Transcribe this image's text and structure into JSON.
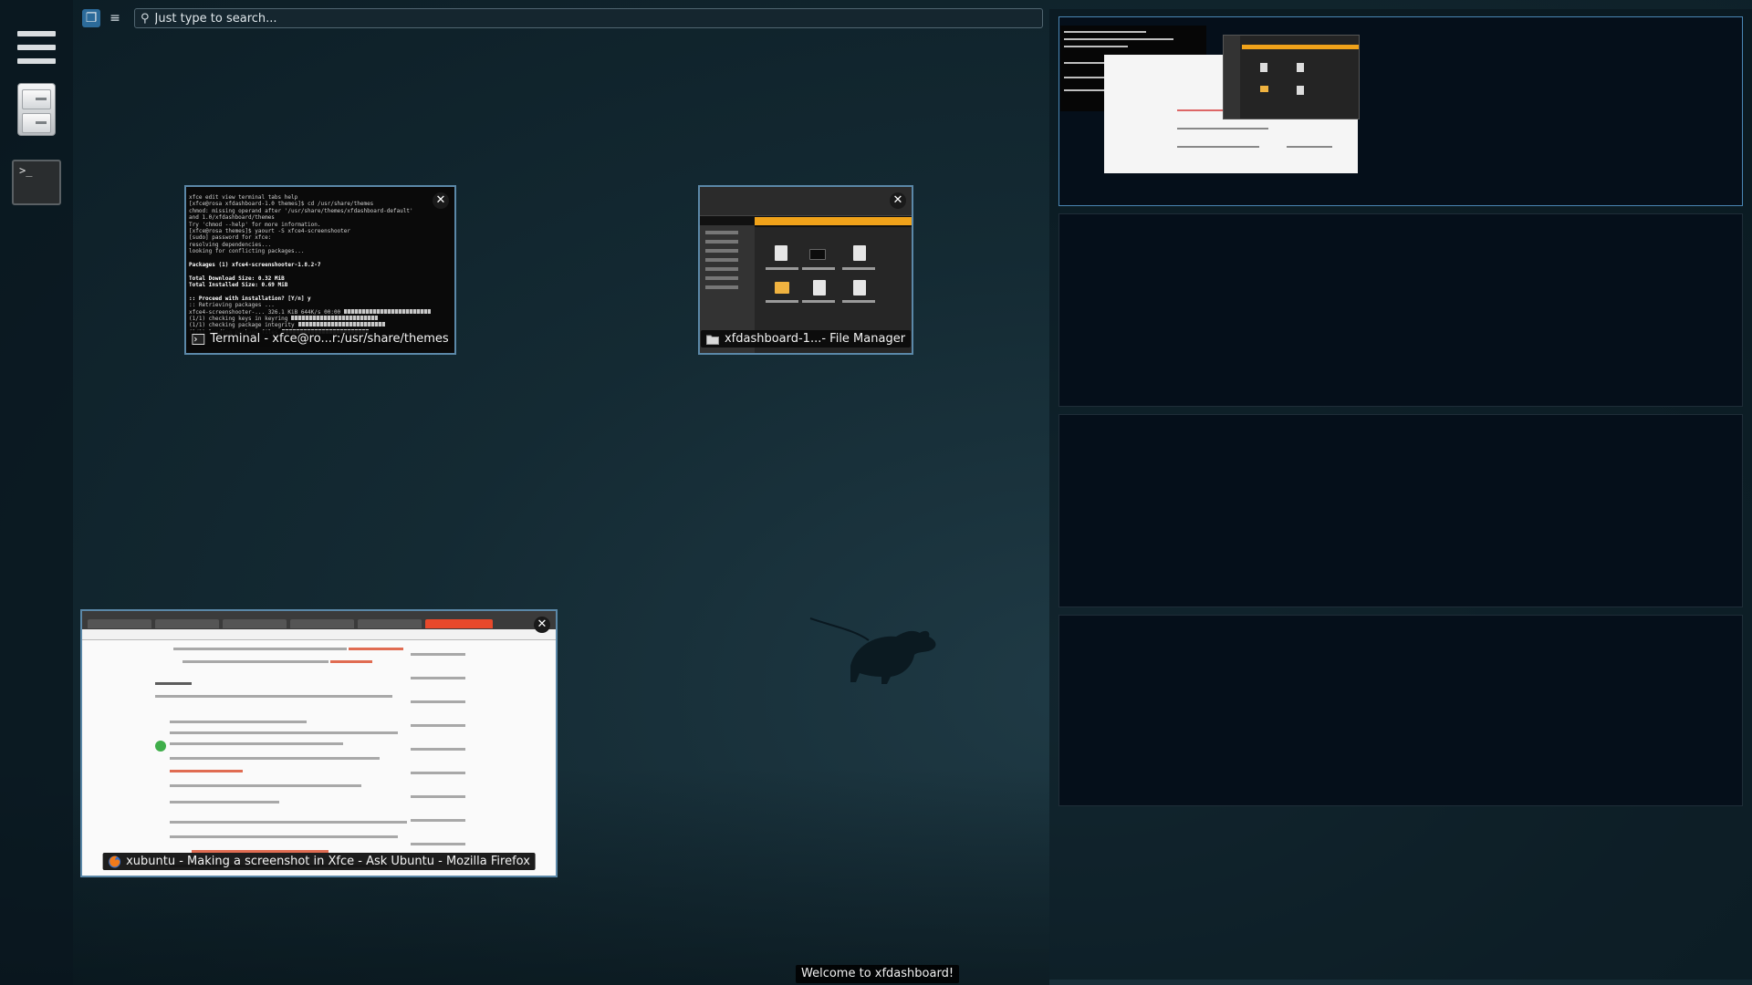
{
  "search": {
    "placeholder": "Just type to search..."
  },
  "views": {
    "windows_view_icon": "windows-view-icon",
    "applications_view_icon": "applications-view-icon"
  },
  "dock": {
    "items": [
      {
        "icon": "applications-menu-icon"
      },
      {
        "icon": "file-manager-icon"
      },
      {
        "icon": "terminal-icon"
      }
    ]
  },
  "windows": {
    "terminal": {
      "title": "Terminal - xfce@ro...r:/usr/share/themes",
      "icon": "terminal-icon"
    },
    "file_manager": {
      "title": "xfdashboard-1...- File Manager",
      "icon": "folder-icon"
    },
    "firefox": {
      "title": "xubuntu - Making a screenshot in Xfce - Ask Ubuntu - Mozilla Firefox",
      "icon": "firefox-icon"
    }
  },
  "workspaces": {
    "count": 4,
    "active_index": 0
  },
  "status": {
    "message": "Welcome to xfdashboard!"
  },
  "colors": {
    "selection_border": "#5b88a8",
    "active_view": "#2c6b9a",
    "warning_bar": "#f0a21a",
    "accent_link": "#e06c52"
  }
}
